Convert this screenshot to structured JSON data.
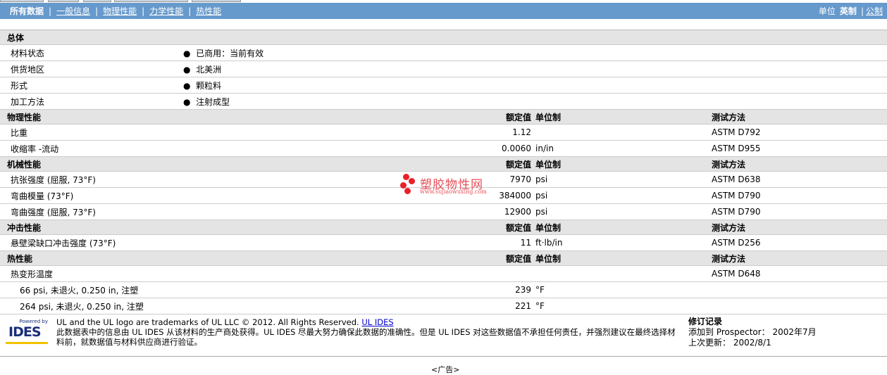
{
  "nav": {
    "tabs": [
      "所有数据",
      "一般信息",
      "物理性能",
      "力学性能",
      "热性能"
    ],
    "units_label": "单位",
    "unit_english": "英制",
    "unit_metric": "公制"
  },
  "sections": [
    {
      "title": "总体",
      "rows": [
        {
          "label": "材料状态",
          "bullet": "已商用：当前有效"
        },
        {
          "label": "供货地区",
          "bullet": "北美洲"
        },
        {
          "label": "形式",
          "bullet": "颗粒料"
        },
        {
          "label": "加工方法",
          "bullet": "注射成型"
        }
      ]
    },
    {
      "title": "物理性能",
      "h_val": "额定值",
      "h_unit": "单位制",
      "h_test": "测试方法",
      "rows": [
        {
          "label": "比重",
          "val": "1.12",
          "unit": "",
          "test": "ASTM D792"
        },
        {
          "label": "收缩率 -流动",
          "val": "0.0060",
          "unit": "in/in",
          "test": "ASTM D955"
        }
      ]
    },
    {
      "title": "机械性能",
      "h_val": "额定值",
      "h_unit": "单位制",
      "h_test": "测试方法",
      "rows": [
        {
          "label": "抗张强度 (屈服, 73°F)",
          "val": "7970",
          "unit": "psi",
          "test": "ASTM D638"
        },
        {
          "label": "弯曲模量 (73°F)",
          "val": "384000",
          "unit": "psi",
          "test": "ASTM D790"
        },
        {
          "label": "弯曲强度 (屈服, 73°F)",
          "val": "12900",
          "unit": "psi",
          "test": "ASTM D790"
        }
      ]
    },
    {
      "title": "冲击性能",
      "h_val": "额定值",
      "h_unit": "单位制",
      "h_test": "测试方法",
      "rows": [
        {
          "label": "悬壁梁缺口冲击强度 (73°F)",
          "val": "11",
          "unit": "ft·lb/in",
          "test": "ASTM D256"
        }
      ]
    },
    {
      "title": "热性能",
      "h_val": "额定值",
      "h_unit": "单位制",
      "h_test": "测试方法",
      "rows": [
        {
          "label": "热变形温度",
          "val": "",
          "unit": "",
          "test": "ASTM D648"
        },
        {
          "label": "66 psi, 未退火, 0.250 in, 注塑",
          "val": "239",
          "unit": "°F",
          "test": "",
          "sub": true
        },
        {
          "label": "264 psi, 未退火, 0.250 in, 注塑",
          "val": "221",
          "unit": "°F",
          "test": "",
          "sub": true
        }
      ]
    }
  ],
  "watermark": {
    "name": "塑胶物性网",
    "url": "www.sujiaowuxing.com"
  },
  "footer": {
    "logo_powered": "Powered by",
    "logo_text": "IDES",
    "line1": "UL and the UL logo are trademarks of UL LLC © 2012. All Rights Reserved.",
    "link": "UL IDES",
    "line2": "此数据表中的信息由 UL IDES 从该材料的生产商处获得。UL IDES 尽最大努力确保此数据的准确性。但是 UL IDES 对这些数据值不承担任何责任，并强烈建议在最终选择材料前，就数据值与材料供应商进行验证。",
    "rev_title": "修订记录",
    "rev_added": "添加到 Prospector： 2002年7月",
    "rev_updated": "上次更新： 2002/8/1"
  },
  "ad": "<广告>"
}
